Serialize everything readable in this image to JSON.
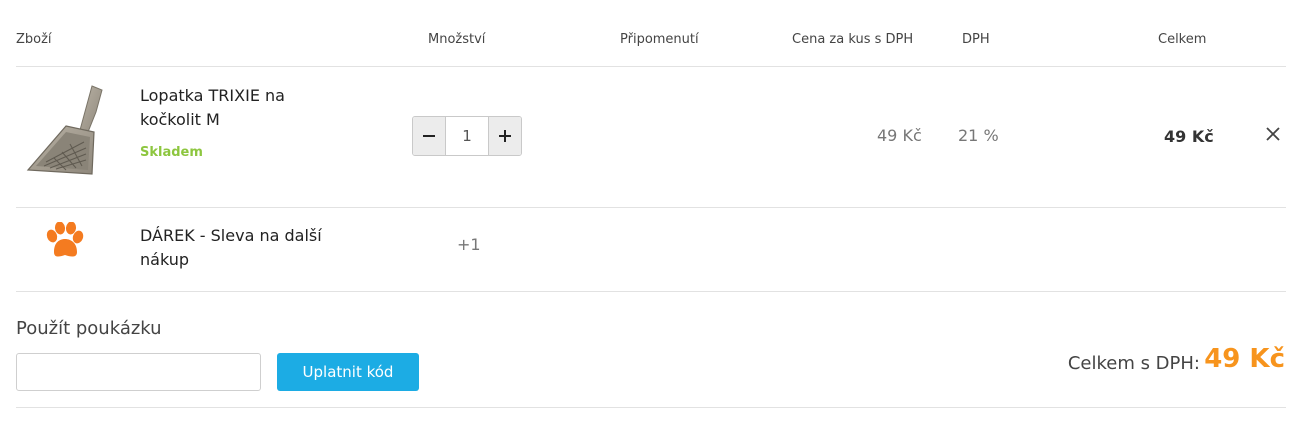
{
  "header": {
    "col_product": "Zboží",
    "col_quantity": "Množství",
    "col_reminder": "Připomenutí",
    "col_unit_price": "Cena za kus s DPH",
    "col_vat": "DPH",
    "col_total": "Celkem"
  },
  "items": [
    {
      "name": "Lopatka TRIXIE na kočkolit M",
      "availability": "Skladem",
      "quantity": "1",
      "unit_price": "49 Kč",
      "vat": "21 %",
      "total": "49 Kč",
      "icon": "litter-scoop-image",
      "remove_icon": "close-icon"
    },
    {
      "name": "DÁREK - Sleva na další nákup",
      "quantity": "+1",
      "icon": "paw-icon"
    }
  ],
  "voucher": {
    "title": "Použít poukázku",
    "input_value": "",
    "apply_label": "Uplatnit kód"
  },
  "summary": {
    "label": "Celkem s DPH:",
    "value": "49 Kč"
  },
  "colors": {
    "accent_blue": "#1cace4",
    "accent_orange": "#f7941d",
    "stock_green": "#8dc63f",
    "divider": "#e2e2e2"
  }
}
